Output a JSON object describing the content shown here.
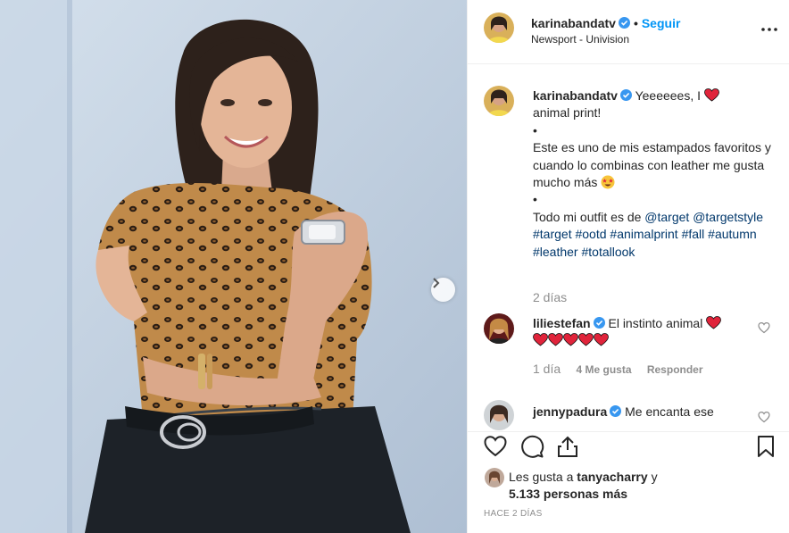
{
  "post": {
    "username": "karinabandatv",
    "follow_label": "Seguir",
    "separator": "•",
    "location": "Newsport - Univision",
    "caption": {
      "part1": "Yeeeeees, I",
      "part2": "animal print!",
      "bullet": "•",
      "para": "Este es uno de mis estampados favoritos y cuando lo combinas con leather me gusta mucho más",
      "outfit_prefix": "Todo mi outfit es de",
      "tags": [
        "@target",
        "@targetstyle",
        "#target",
        "#ootd",
        "#animalprint",
        "#fall",
        "#autumn",
        "#leather",
        "#totallook"
      ]
    },
    "caption_age": "2 días",
    "comments": [
      {
        "username": "liliestefan",
        "text": "El instinto animal",
        "age": "1 día",
        "likes": "4 Me gusta",
        "reply": "Responder"
      },
      {
        "username": "jennypadura",
        "text": "Me encanta ese"
      }
    ],
    "liked_by": {
      "prefix": "Les gusta a",
      "user": "tanyacharry",
      "joiner": "y",
      "count": "5.133 personas más"
    },
    "timestamp": "HACE 2 DÍAS"
  },
  "icons": {
    "verified": "verified-badge-icon",
    "more": "more-options-icon",
    "like": "heart-icon",
    "comment": "comment-icon",
    "share": "share-icon",
    "save": "bookmark-icon",
    "next": "chevron-right-icon"
  },
  "colors": {
    "accent": "#0095f6",
    "verified": "#3897f0",
    "heart": "#ed4956",
    "muted": "#8e8e8e",
    "hashtag": "#00376b"
  }
}
